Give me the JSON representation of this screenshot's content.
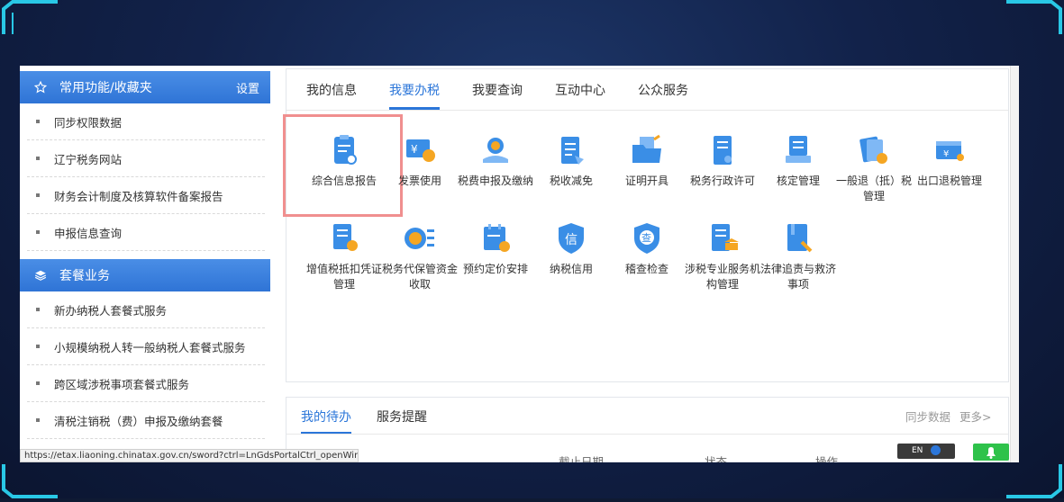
{
  "sidebar": {
    "favorites_title": "常用功能/收藏夹",
    "favorites_setting": "设置",
    "favorites_items": [
      {
        "label": "同步权限数据"
      },
      {
        "label": "辽宁税务网站"
      },
      {
        "label": "财务会计制度及核算软件备案报告"
      },
      {
        "label": "申报信息查询"
      }
    ],
    "package_title": "套餐业务",
    "package_items": [
      {
        "label": "新办纳税人套餐式服务"
      },
      {
        "label": "小规模纳税人转一般纳税人套餐式服务"
      },
      {
        "label": "跨区域涉税事项套餐式服务"
      },
      {
        "label": "清税注销税（费）申报及缴纳套餐"
      }
    ]
  },
  "tabs": [
    {
      "label": "我的信息"
    },
    {
      "label": "我要办税"
    },
    {
      "label": "我要查询"
    },
    {
      "label": "互动中心"
    },
    {
      "label": "公众服务"
    }
  ],
  "active_tab": "我要办税",
  "tiles": [
    {
      "label": "综合信息报告",
      "icon": "clipboard-icon"
    },
    {
      "label": "发票使用",
      "icon": "invoice-icon"
    },
    {
      "label": "税费申报及缴纳",
      "icon": "money-hand-icon"
    },
    {
      "label": "税收减免",
      "icon": "list-tag-icon"
    },
    {
      "label": "证明开具",
      "icon": "folder-doc-icon"
    },
    {
      "label": "税务行政许可",
      "icon": "permit-doc-icon"
    },
    {
      "label": "核定管理",
      "icon": "stamp-icon"
    },
    {
      "label": "一般退（抵）税管理",
      "icon": "refund-gear-icon"
    },
    {
      "label": "出口退税管理",
      "icon": "export-refund-icon"
    },
    {
      "label": "增值税抵扣凭证管理",
      "icon": "vat-gear-icon"
    },
    {
      "label": "税务代保管资金收取",
      "icon": "coin-list-icon"
    },
    {
      "label": "预约定价安排",
      "icon": "calendar-check-icon"
    },
    {
      "label": "纳税信用",
      "icon": "credit-shield-icon"
    },
    {
      "label": "稽查检查",
      "icon": "inspect-shield-icon"
    },
    {
      "label": "涉税专业服务机构管理",
      "icon": "agency-building-icon"
    },
    {
      "label": "法律追责与救济事项",
      "icon": "law-book-icon"
    }
  ],
  "bottom": {
    "tabs": [
      {
        "label": "我的待办"
      },
      {
        "label": "服务提醒"
      }
    ],
    "sync_label": "同步数据",
    "more_label": "更多>",
    "columns": [
      {
        "label": "截止日期"
      },
      {
        "label": "状态"
      },
      {
        "label": "操作"
      }
    ]
  },
  "status_url": "https://etax.liaoning.chinatax.gov.cn/sword?ctrl=LnGdsPortalCtrl_openWin...",
  "ime_label": "EN",
  "colors": {
    "accent": "#2b76d9",
    "highlight": "#f08f8f",
    "sidebar_header": "#3a80df"
  }
}
